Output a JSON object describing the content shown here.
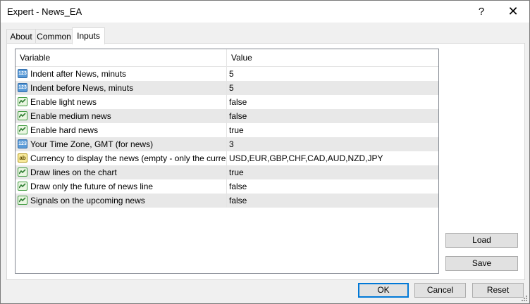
{
  "window": {
    "title": "Expert - News_EA",
    "help_glyph": "?",
    "close_glyph": "✕"
  },
  "tabs": [
    {
      "label": "About",
      "active": false
    },
    {
      "label": "Common",
      "active": false
    },
    {
      "label": "Inputs",
      "active": true
    }
  ],
  "grid": {
    "headers": {
      "variable": "Variable",
      "value": "Value"
    },
    "rows": [
      {
        "icon": "int-icon",
        "variable": "Indent after News, minuts",
        "value": "5"
      },
      {
        "icon": "int-icon",
        "variable": "Indent before News, minuts",
        "value": "5"
      },
      {
        "icon": "bool-icon",
        "variable": "Enable light news",
        "value": "false"
      },
      {
        "icon": "bool-icon",
        "variable": "Enable medium news",
        "value": "false"
      },
      {
        "icon": "bool-icon",
        "variable": "Enable hard news",
        "value": "true"
      },
      {
        "icon": "int-icon",
        "variable": "Your Time Zone, GMT (for news)",
        "value": "3"
      },
      {
        "icon": "string-icon",
        "variable": "Currency to display the news (empty - only the current cu...",
        "value": "USD,EUR,GBP,CHF,CAD,AUD,NZD,JPY"
      },
      {
        "icon": "bool-icon",
        "variable": "Draw lines on the chart",
        "value": "true"
      },
      {
        "icon": "bool-icon",
        "variable": "Draw only the future of news line",
        "value": "false"
      },
      {
        "icon": "bool-icon",
        "variable": "Signals on the upcoming news",
        "value": "false"
      }
    ]
  },
  "icons": {
    "int_text": "123",
    "string_text": "ab"
  },
  "buttons": {
    "load": "Load",
    "save": "Save",
    "ok": "OK",
    "cancel": "Cancel",
    "reset": "Reset"
  }
}
